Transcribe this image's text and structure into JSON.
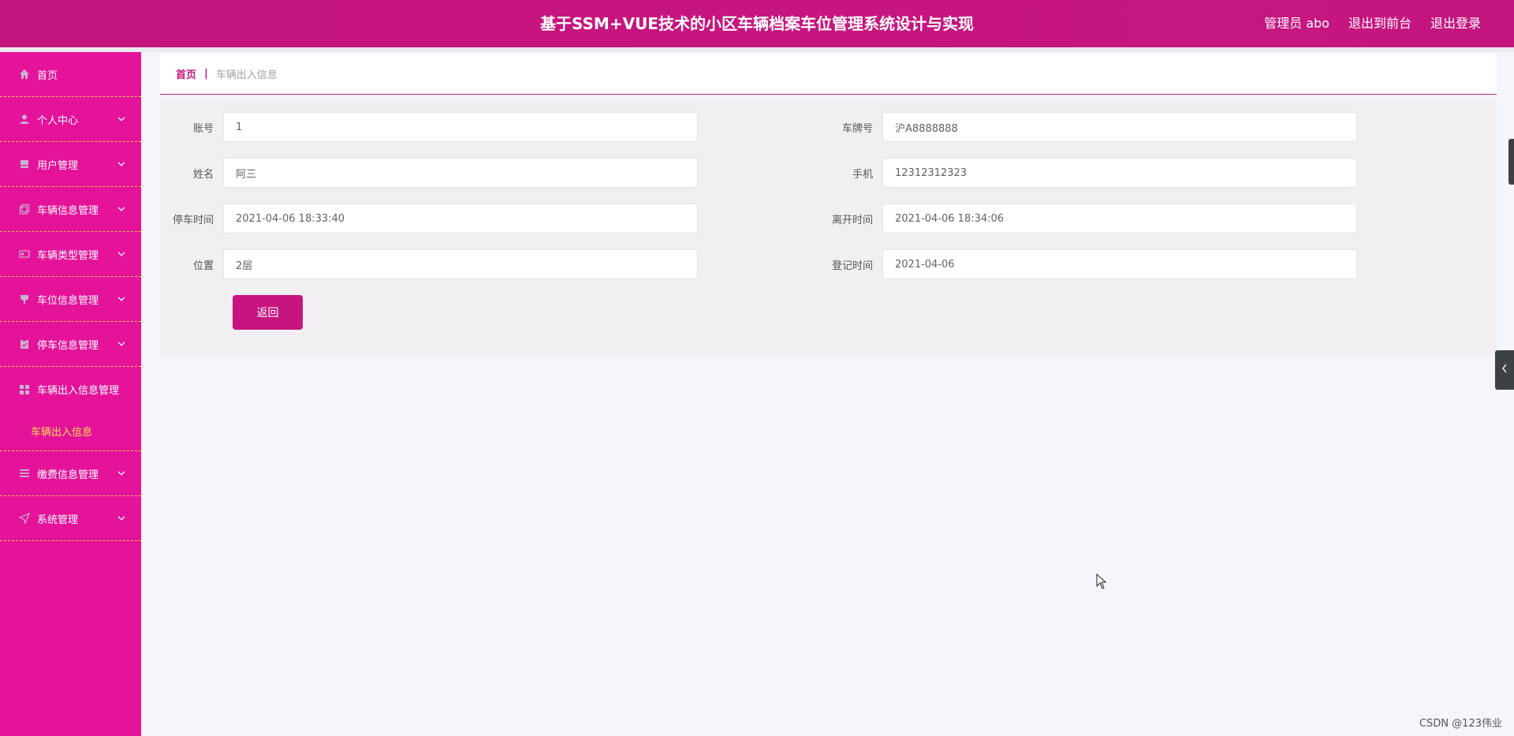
{
  "header": {
    "title": "基于SSM+VUE技术的小区车辆档案车位管理系统设计与实现",
    "user": "管理员 abo",
    "to_front": "退出到前台",
    "logout": "退出登录"
  },
  "sidebar": {
    "items": [
      {
        "label": "首页",
        "icon": "home-icon"
      },
      {
        "label": "个人中心",
        "icon": "user-icon"
      },
      {
        "label": "用户管理",
        "icon": "printer-icon"
      },
      {
        "label": "车辆信息管理",
        "icon": "copy-icon"
      },
      {
        "label": "车辆类型管理",
        "icon": "card-icon"
      },
      {
        "label": "车位信息管理",
        "icon": "cup-icon"
      },
      {
        "label": "停车信息管理",
        "icon": "clipboard-icon"
      },
      {
        "label": "车辆出入信息管理",
        "icon": "grid-icon"
      },
      {
        "label": "缴费信息管理",
        "icon": "list-icon"
      },
      {
        "label": "系统管理",
        "icon": "send-icon"
      }
    ],
    "active_sub": "车辆出入信息"
  },
  "breadcrumb": {
    "home": "首页",
    "sep": "|",
    "current": "车辆出入信息"
  },
  "form": {
    "account_label": "账号",
    "account_value": "1",
    "plate_label": "车牌号",
    "plate_value": "沪A8888888",
    "name_label": "姓名",
    "name_value": "阿三",
    "phone_label": "手机",
    "phone_value": "12312312323",
    "park_time_label": "停车时间",
    "park_time_value": "2021-04-06 18:33:40",
    "leave_time_label": "离开时间",
    "leave_time_value": "2021-04-06 18:34:06",
    "location_label": "位置",
    "location_value": "2层",
    "register_time_label": "登记时间",
    "register_time_value": "2021-04-06",
    "back_button": "返回"
  },
  "watermark": "CSDN @123伟业",
  "colors": {
    "header": "#c7157f",
    "sidebar": "#e4139a",
    "submenu_active": "#ffde4c",
    "accent": "#c7157f"
  }
}
